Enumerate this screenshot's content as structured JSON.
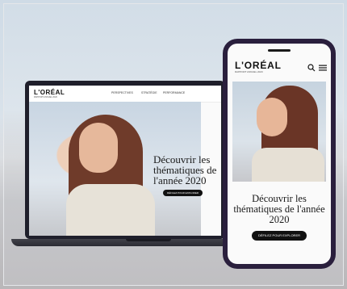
{
  "brand": {
    "logo": "L'ORÉAL",
    "subtitle": "RAPPORT ANNUEL 2020"
  },
  "laptop": {
    "nav": [
      "PERSPECTIVES",
      "STRATÉGIE",
      "PERFORMANCE"
    ],
    "hero_title": "Découvrir les thématiques de l'année 2020",
    "cta_label": "DÉFILEZ POUR EXPLORER"
  },
  "phone": {
    "hero_title": "Découvrir les thématiques de l'année 2020",
    "cta_label": "DÉFILEZ POUR EXPLORER",
    "icons": [
      "search-icon",
      "menu-icon"
    ]
  }
}
